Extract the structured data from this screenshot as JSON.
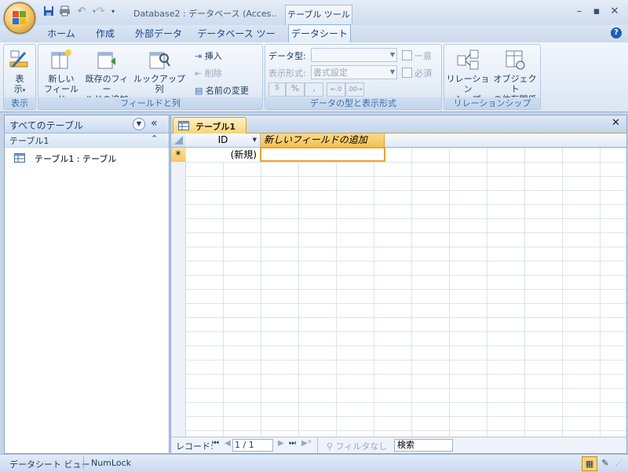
{
  "window": {
    "title": "Database2 : データベース (Acces...",
    "context_tab_title": "テーブル ツール"
  },
  "ribbon_tabs": [
    {
      "label": "ホーム"
    },
    {
      "label": "作成"
    },
    {
      "label": "外部データ"
    },
    {
      "label": "データベース ツール"
    },
    {
      "label": "データシート"
    }
  ],
  "active_tab": "データシート",
  "ribbon": {
    "view_group": {
      "label": "表示",
      "view_button_line1": "表",
      "view_button_line2": "示"
    },
    "fields_group": {
      "label": "フィールドと列",
      "new_field_line1": "新しい",
      "new_field_line2": "フィールド",
      "existing_field_line1": "既存のフィー",
      "existing_field_line2": "ルドの追加",
      "lookup_column": "ルックアップ列",
      "insert": "挿入",
      "delete": "削除",
      "rename": "名前の変更"
    },
    "datatype_group": {
      "label": "データの型と表示形式",
      "datatype_label": "データ型:",
      "datatype_value": "",
      "format_label": "表示形式:",
      "format_value": "書式設定",
      "unique": "一意",
      "required": "必須",
      "percent": "%",
      "comma": ","
    },
    "relationships_group": {
      "label": "リレーションシップ",
      "relationships_line1": "リレーション",
      "relationships_line2": "シップ",
      "dependencies_line1": "オブジェクト",
      "dependencies_line2": "の依存関係"
    }
  },
  "nav_pane": {
    "header": "すべてのテーブル",
    "group": "テーブル1",
    "items": [
      {
        "label": "テーブル1 : テーブル"
      }
    ]
  },
  "document": {
    "tab_label": "テーブル1",
    "columns": [
      "ID",
      "新しいフィールドの追加"
    ],
    "new_row_marker": "*",
    "new_row_value": "(新規)"
  },
  "record_nav": {
    "label": "レコード:",
    "position": "1 / 1",
    "filter": "フィルタなし",
    "search_placeholder": "検索"
  },
  "status_bar": {
    "view": "データシート ビュー",
    "numlock": "NumLock"
  },
  "colors": {
    "accent": "#f8d476",
    "ribbon_blue": "#c5d4e7",
    "selected_border": "#f0a030"
  }
}
